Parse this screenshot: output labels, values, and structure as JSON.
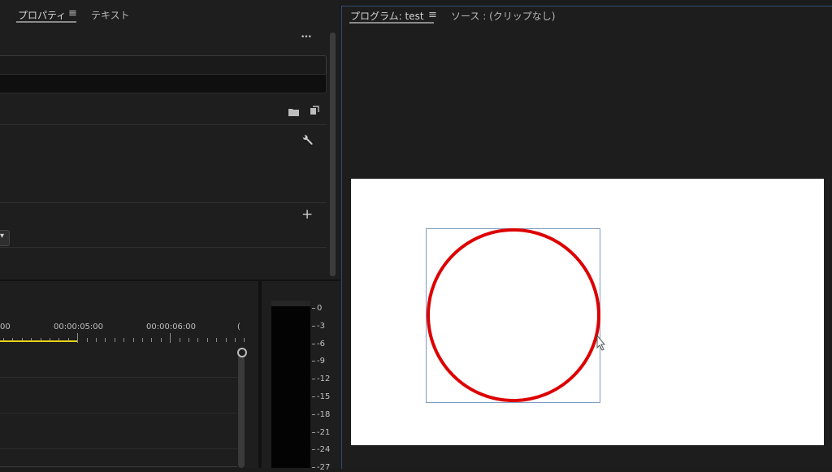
{
  "left_panel": {
    "tabs": [
      "プロパティ",
      "テキスト"
    ],
    "menu_glyph": "≡",
    "more_glyph": "•••",
    "folder_icon": "folder-icon",
    "new_item_icon": "new-item-icon",
    "wrench_icon": "wrench-icon",
    "add_glyph": "+",
    "dropdown_glyph": "▾"
  },
  "timeline": {
    "timecodes": [
      "00",
      "00:00:05:00",
      "00:00:06:00",
      "("
    ]
  },
  "audio_meter": {
    "db_labels": [
      "0",
      "-3",
      "-6",
      "-9",
      "-12",
      "-15",
      "-18",
      "-21",
      "-24",
      "-27"
    ]
  },
  "program_monitor": {
    "tab_program": "プログラム: test",
    "menu_glyph": "≡",
    "tab_source": "ソース : (クリップなし)"
  },
  "colors": {
    "accent_blue": "#2f4c77",
    "playhead_yellow": "#e8d11a",
    "circle_red": "#dd0000",
    "selection_box": "#7f9bc0"
  }
}
